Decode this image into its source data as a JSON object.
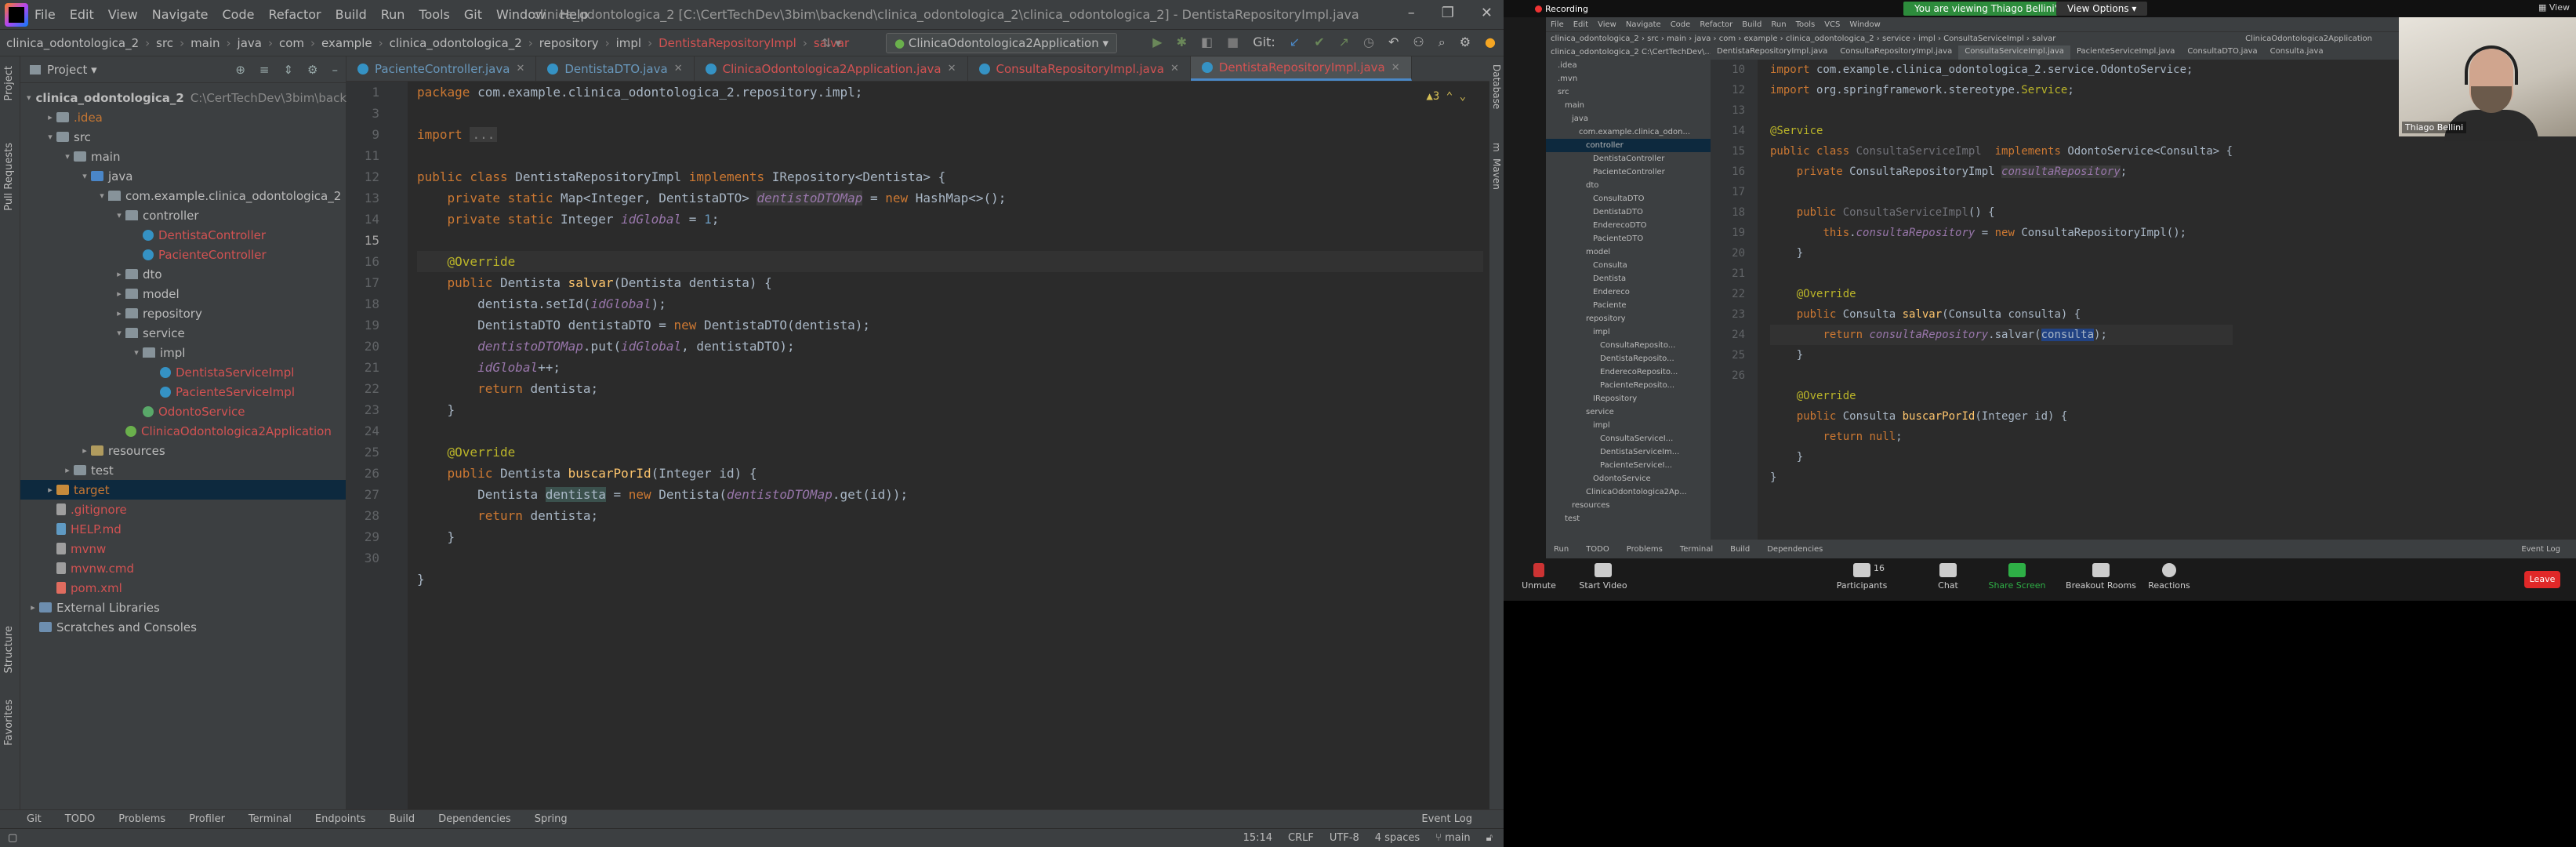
{
  "ide": {
    "menu": [
      "File",
      "Edit",
      "View",
      "Navigate",
      "Code",
      "Refactor",
      "Build",
      "Run",
      "Tools",
      "Git",
      "Window",
      "Help"
    ],
    "window_title": "clinica_odontologica_2 [C:\\CertTechDev\\3bim\\backend\\clinica_odontologica_2\\clinica_odontologica_2] - DentistaRepositoryImpl.java",
    "breadcrumbs": [
      "clinica_odontologica_2",
      "src",
      "main",
      "java",
      "com",
      "example",
      "clinica_odontologica_2",
      "repository",
      "impl",
      "DentistaRepositoryImpl",
      "salvar"
    ],
    "run_config": "ClinicaOdontologica2Application",
    "git_label": "Git:",
    "project_panel_title": "Project",
    "tree": [
      {
        "depth": 0,
        "arrow": "▾",
        "icon": "folder",
        "label": "clinica_odontologica_2",
        "suffix": "C:\\CertTechDev\\3bim\\backend",
        "cls": ""
      },
      {
        "depth": 1,
        "arrow": "▸",
        "icon": "folder",
        "label": ".idea",
        "cls": "t-orange"
      },
      {
        "depth": 1,
        "arrow": "▾",
        "icon": "folder",
        "label": "src",
        "cls": ""
      },
      {
        "depth": 2,
        "arrow": "▾",
        "icon": "folder",
        "label": "main",
        "cls": ""
      },
      {
        "depth": 3,
        "arrow": "▾",
        "icon": "src",
        "label": "java",
        "cls": ""
      },
      {
        "depth": 4,
        "arrow": "▾",
        "icon": "pkg",
        "label": "com.example.clinica_odontologica_2",
        "cls": ""
      },
      {
        "depth": 5,
        "arrow": "▾",
        "icon": "pkg",
        "label": "controller",
        "cls": ""
      },
      {
        "depth": 6,
        "arrow": "",
        "icon": "cls",
        "label": "DentistaController",
        "cls": "t-red"
      },
      {
        "depth": 6,
        "arrow": "",
        "icon": "cls",
        "label": "PacienteController",
        "cls": "t-red"
      },
      {
        "depth": 5,
        "arrow": "▸",
        "icon": "pkg",
        "label": "dto",
        "cls": ""
      },
      {
        "depth": 5,
        "arrow": "▸",
        "icon": "pkg",
        "label": "model",
        "cls": ""
      },
      {
        "depth": 5,
        "arrow": "▸",
        "icon": "pkg",
        "label": "repository",
        "cls": ""
      },
      {
        "depth": 5,
        "arrow": "▾",
        "icon": "pkg",
        "label": "service",
        "cls": ""
      },
      {
        "depth": 6,
        "arrow": "▾",
        "icon": "pkg",
        "label": "impl",
        "cls": ""
      },
      {
        "depth": 7,
        "arrow": "",
        "icon": "cls",
        "label": "DentistaServiceImpl",
        "cls": "t-red"
      },
      {
        "depth": 7,
        "arrow": "",
        "icon": "cls",
        "label": "PacienteServiceImpl",
        "cls": "t-red"
      },
      {
        "depth": 6,
        "arrow": "",
        "icon": "iface",
        "label": "OdontoService",
        "cls": "t-red"
      },
      {
        "depth": 5,
        "arrow": "",
        "icon": "spring",
        "label": "ClinicaOdontologica2Application",
        "cls": "t-red"
      },
      {
        "depth": 3,
        "arrow": "▸",
        "icon": "res",
        "label": "resources",
        "cls": ""
      },
      {
        "depth": 2,
        "arrow": "▸",
        "icon": "folder",
        "label": "test",
        "cls": ""
      },
      {
        "depth": 1,
        "arrow": "▸",
        "icon": "tgt",
        "label": "target",
        "cls": "t-orange",
        "sel": true
      },
      {
        "depth": 1,
        "arrow": "",
        "icon": "file",
        "label": ".gitignore",
        "cls": "t-red"
      },
      {
        "depth": 1,
        "arrow": "",
        "icon": "md",
        "label": "HELP.md",
        "cls": "t-red"
      },
      {
        "depth": 1,
        "arrow": "",
        "icon": "file",
        "label": "mvnw",
        "cls": "t-red"
      },
      {
        "depth": 1,
        "arrow": "",
        "icon": "file",
        "label": "mvnw.cmd",
        "cls": "t-red"
      },
      {
        "depth": 1,
        "arrow": "",
        "icon": "xml",
        "label": "pom.xml",
        "cls": "t-red"
      },
      {
        "depth": 0,
        "arrow": "▸",
        "icon": "lib",
        "label": "External Libraries",
        "cls": ""
      },
      {
        "depth": 0,
        "arrow": "",
        "icon": "lib",
        "label": "Scratches and Consoles",
        "cls": ""
      }
    ],
    "tabs": [
      {
        "label": "PacienteController.java",
        "active": false
      },
      {
        "label": "DentistaDTO.java",
        "active": false
      },
      {
        "label": "ClinicaOdontologica2Application.java",
        "active": false
      },
      {
        "label": "ConsultaRepositoryImpl.java",
        "active": false
      },
      {
        "label": "DentistaRepositoryImpl.java",
        "active": true
      }
    ],
    "warning_count": "▲3",
    "line_numbers": [
      "1",
      "3",
      "",
      "9",
      "",
      "11",
      "12",
      "13",
      "14",
      "15",
      "16",
      "17",
      "18",
      "19",
      "20",
      "21",
      "22",
      "23",
      "24",
      "25",
      "26",
      "27",
      "28",
      "29",
      "30"
    ],
    "left_strip": [
      "Project",
      "Pull Requests",
      "Structure",
      "Favorites"
    ],
    "right_strip": [
      "Database",
      "m",
      "Maven"
    ],
    "bottom_tools": [
      "Git",
      "TODO",
      "Problems",
      "Profiler",
      "Terminal",
      "Endpoints",
      "Build",
      "Dependencies",
      "Spring"
    ],
    "event_log": "Event Log",
    "status": {
      "position": "15:14",
      "line_sep": "CRLF",
      "encoding": "UTF-8",
      "indent": "4 spaces",
      "branch": "main"
    }
  },
  "zoom": {
    "recording": "Recording",
    "viewing_banner": "You are viewing Thiago Bellini's screen",
    "view_options": "View Options",
    "participant_name": "Thiago Bellini",
    "participant_count": "16",
    "controls": [
      "Unmute",
      "Start Video",
      "Participants",
      "Chat",
      "Share Screen",
      "Breakout Rooms",
      "Reactions"
    ],
    "leave": "Leave",
    "shared_tabs": [
      "DentistaRepositoryImpl.java",
      "ConsultaRepositoryImpl.java",
      "ConsultaServiceImpl.java",
      "PacienteServiceImpl.java",
      "ConsultaDTO.java",
      "Consulta.java"
    ],
    "shared_nav": "clinica_odontologica_2 › src › main › java › com › example › clinica_odontologica_2 › service › impl › ConsultaServiceImpl › salvar",
    "shared_run_config": "ClinicaOdontologica2Application",
    "shared_tree": [
      {
        "d": 0,
        "t": "clinica_odontologica_2 C:\\CertTechDev\\..."
      },
      {
        "d": 1,
        "t": ".idea"
      },
      {
        "d": 1,
        "t": ".mvn"
      },
      {
        "d": 1,
        "t": "src"
      },
      {
        "d": 2,
        "t": "main"
      },
      {
        "d": 3,
        "t": "java"
      },
      {
        "d": 4,
        "t": "com.example.clinica_odon..."
      },
      {
        "d": 5,
        "t": "controller",
        "sel": true
      },
      {
        "d": 6,
        "t": "DentistaController"
      },
      {
        "d": 6,
        "t": "PacienteController"
      },
      {
        "d": 5,
        "t": "dto"
      },
      {
        "d": 6,
        "t": "ConsultaDTO"
      },
      {
        "d": 6,
        "t": "DentistaDTO"
      },
      {
        "d": 6,
        "t": "EnderecoDTO"
      },
      {
        "d": 6,
        "t": "PacienteDTO"
      },
      {
        "d": 5,
        "t": "model"
      },
      {
        "d": 6,
        "t": "Consulta"
      },
      {
        "d": 6,
        "t": "Dentista"
      },
      {
        "d": 6,
        "t": "Endereco"
      },
      {
        "d": 6,
        "t": "Paciente"
      },
      {
        "d": 5,
        "t": "repository"
      },
      {
        "d": 6,
        "t": "impl"
      },
      {
        "d": 7,
        "t": "ConsultaReposito..."
      },
      {
        "d": 7,
        "t": "DentistaReposito..."
      },
      {
        "d": 7,
        "t": "EnderecoReposito..."
      },
      {
        "d": 7,
        "t": "PacienteReposito..."
      },
      {
        "d": 6,
        "t": "IRepository"
      },
      {
        "d": 5,
        "t": "service"
      },
      {
        "d": 6,
        "t": "impl"
      },
      {
        "d": 7,
        "t": "ConsultaServiceI..."
      },
      {
        "d": 7,
        "t": "DentistaServiceIm..."
      },
      {
        "d": 7,
        "t": "PacienteServiceI..."
      },
      {
        "d": 6,
        "t": "OdontoService"
      },
      {
        "d": 5,
        "t": "ClinicaOdontologica2Ap..."
      },
      {
        "d": 3,
        "t": "resources"
      },
      {
        "d": 2,
        "t": "test"
      }
    ],
    "shared_line_numbers": [
      "",
      "",
      "",
      "",
      "",
      "",
      "",
      "",
      "",
      "10",
      "",
      "12",
      "13",
      "14",
      "15",
      "16",
      "17",
      "18",
      "19",
      "20",
      "21",
      "22",
      "23",
      "24",
      "25",
      "26"
    ],
    "shared_status": [
      "Run",
      "TODO",
      "Problems",
      "Terminal",
      "Build",
      "Dependencies"
    ],
    "shared_event_log": "Event Log"
  }
}
